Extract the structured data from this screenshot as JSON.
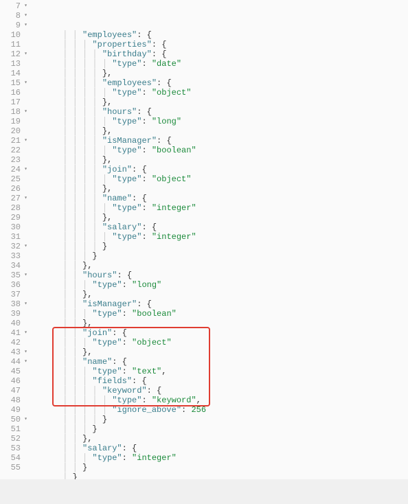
{
  "editor": {
    "gutter": [
      {
        "n": "7",
        "fold": true
      },
      {
        "n": "8",
        "fold": true
      },
      {
        "n": "9",
        "fold": true
      },
      {
        "n": "10",
        "fold": false
      },
      {
        "n": "11",
        "fold": false
      },
      {
        "n": "12",
        "fold": true
      },
      {
        "n": "13",
        "fold": false
      },
      {
        "n": "14",
        "fold": false
      },
      {
        "n": "15",
        "fold": true
      },
      {
        "n": "16",
        "fold": false
      },
      {
        "n": "17",
        "fold": false
      },
      {
        "n": "18",
        "fold": true
      },
      {
        "n": "19",
        "fold": false
      },
      {
        "n": "20",
        "fold": false
      },
      {
        "n": "21",
        "fold": true
      },
      {
        "n": "22",
        "fold": false
      },
      {
        "n": "23",
        "fold": false
      },
      {
        "n": "24",
        "fold": true
      },
      {
        "n": "25",
        "fold": false
      },
      {
        "n": "26",
        "fold": false
      },
      {
        "n": "27",
        "fold": true
      },
      {
        "n": "28",
        "fold": false
      },
      {
        "n": "29",
        "fold": false
      },
      {
        "n": "30",
        "fold": false
      },
      {
        "n": "31",
        "fold": false
      },
      {
        "n": "32",
        "fold": true
      },
      {
        "n": "33",
        "fold": false
      },
      {
        "n": "34",
        "fold": false
      },
      {
        "n": "35",
        "fold": true
      },
      {
        "n": "36",
        "fold": false
      },
      {
        "n": "37",
        "fold": false
      },
      {
        "n": "38",
        "fold": true
      },
      {
        "n": "39",
        "fold": false
      },
      {
        "n": "40",
        "fold": false
      },
      {
        "n": "41",
        "fold": true
      },
      {
        "n": "42",
        "fold": false
      },
      {
        "n": "43",
        "fold": true
      },
      {
        "n": "44",
        "fold": true
      },
      {
        "n": "45",
        "fold": false
      },
      {
        "n": "46",
        "fold": false
      },
      {
        "n": "47",
        "fold": false
      },
      {
        "n": "48",
        "fold": false
      },
      {
        "n": "49",
        "fold": false
      },
      {
        "n": "50",
        "fold": true
      },
      {
        "n": "51",
        "fold": false
      },
      {
        "n": "52",
        "fold": false
      },
      {
        "n": "53",
        "fold": false
      },
      {
        "n": "54",
        "fold": false
      },
      {
        "n": "55",
        "fold": false
      }
    ],
    "lines": [
      [
        [
          "line",
          "      │ │ "
        ],
        [
          "key",
          "\"employees\""
        ],
        [
          "punc",
          ": {"
        ]
      ],
      [
        [
          "line",
          "      │ │ │ "
        ],
        [
          "key",
          "\"properties\""
        ],
        [
          "punc",
          ": {"
        ]
      ],
      [
        [
          "line",
          "      │ │ │ │ "
        ],
        [
          "key",
          "\"birthday\""
        ],
        [
          "punc",
          ": {"
        ]
      ],
      [
        [
          "line",
          "      │ │ │ │ │ "
        ],
        [
          "key",
          "\"type\""
        ],
        [
          "punc",
          ": "
        ],
        [
          "str",
          "\"date\""
        ]
      ],
      [
        [
          "line",
          "      │ │ │ │ "
        ],
        [
          "punc",
          "},"
        ]
      ],
      [
        [
          "line",
          "      │ │ │ │ "
        ],
        [
          "key",
          "\"employees\""
        ],
        [
          "punc",
          ": {"
        ]
      ],
      [
        [
          "line",
          "      │ │ │ │ │ "
        ],
        [
          "key",
          "\"type\""
        ],
        [
          "punc",
          ": "
        ],
        [
          "str",
          "\"object\""
        ]
      ],
      [
        [
          "line",
          "      │ │ │ │ "
        ],
        [
          "punc",
          "},"
        ]
      ],
      [
        [
          "line",
          "      │ │ │ │ "
        ],
        [
          "key",
          "\"hours\""
        ],
        [
          "punc",
          ": {"
        ]
      ],
      [
        [
          "line",
          "      │ │ │ │ │ "
        ],
        [
          "key",
          "\"type\""
        ],
        [
          "punc",
          ": "
        ],
        [
          "str",
          "\"long\""
        ]
      ],
      [
        [
          "line",
          "      │ │ │ │ "
        ],
        [
          "punc",
          "},"
        ]
      ],
      [
        [
          "line",
          "      │ │ │ │ "
        ],
        [
          "key",
          "\"isManager\""
        ],
        [
          "punc",
          ": {"
        ]
      ],
      [
        [
          "line",
          "      │ │ │ │ │ "
        ],
        [
          "key",
          "\"type\""
        ],
        [
          "punc",
          ": "
        ],
        [
          "str",
          "\"boolean\""
        ]
      ],
      [
        [
          "line",
          "      │ │ │ │ "
        ],
        [
          "punc",
          "},"
        ]
      ],
      [
        [
          "line",
          "      │ │ │ │ "
        ],
        [
          "key",
          "\"join\""
        ],
        [
          "punc",
          ": {"
        ]
      ],
      [
        [
          "line",
          "      │ │ │ │ │ "
        ],
        [
          "key",
          "\"type\""
        ],
        [
          "punc",
          ": "
        ],
        [
          "str",
          "\"object\""
        ]
      ],
      [
        [
          "line",
          "      │ │ │ │ "
        ],
        [
          "punc",
          "},"
        ]
      ],
      [
        [
          "line",
          "      │ │ │ │ "
        ],
        [
          "key",
          "\"name\""
        ],
        [
          "punc",
          ": {"
        ]
      ],
      [
        [
          "line",
          "      │ │ │ │ │ "
        ],
        [
          "key",
          "\"type\""
        ],
        [
          "punc",
          ": "
        ],
        [
          "str",
          "\"integer\""
        ]
      ],
      [
        [
          "line",
          "      │ │ │ │ "
        ],
        [
          "punc",
          "},"
        ]
      ],
      [
        [
          "line",
          "      │ │ │ │ "
        ],
        [
          "key",
          "\"salary\""
        ],
        [
          "punc",
          ": {"
        ]
      ],
      [
        [
          "line",
          "      │ │ │ │ │ "
        ],
        [
          "key",
          "\"type\""
        ],
        [
          "punc",
          ": "
        ],
        [
          "str",
          "\"integer\""
        ]
      ],
      [
        [
          "line",
          "      │ │ │ │ "
        ],
        [
          "punc",
          "}"
        ]
      ],
      [
        [
          "line",
          "      │ │ │ "
        ],
        [
          "punc",
          "}"
        ]
      ],
      [
        [
          "line",
          "      │ │ "
        ],
        [
          "punc",
          "},"
        ]
      ],
      [
        [
          "line",
          "      │ │ "
        ],
        [
          "key",
          "\"hours\""
        ],
        [
          "punc",
          ": {"
        ]
      ],
      [
        [
          "line",
          "      │ │ │ "
        ],
        [
          "key",
          "\"type\""
        ],
        [
          "punc",
          ": "
        ],
        [
          "str",
          "\"long\""
        ]
      ],
      [
        [
          "line",
          "      │ │ "
        ],
        [
          "punc",
          "},"
        ]
      ],
      [
        [
          "line",
          "      │ │ "
        ],
        [
          "key",
          "\"isManager\""
        ],
        [
          "punc",
          ": {"
        ]
      ],
      [
        [
          "line",
          "      │ │ │ "
        ],
        [
          "key",
          "\"type\""
        ],
        [
          "punc",
          ": "
        ],
        [
          "str",
          "\"boolean\""
        ]
      ],
      [
        [
          "line",
          "      │ │ "
        ],
        [
          "punc",
          "},"
        ]
      ],
      [
        [
          "line",
          "      │ │ "
        ],
        [
          "key",
          "\"join\""
        ],
        [
          "punc",
          ": {"
        ]
      ],
      [
        [
          "line",
          "      │ │ │ "
        ],
        [
          "key",
          "\"type\""
        ],
        [
          "punc",
          ": "
        ],
        [
          "str",
          "\"object\""
        ]
      ],
      [
        [
          "line",
          "      │ │ "
        ],
        [
          "punc",
          "},"
        ]
      ],
      [
        [
          "line",
          "      │ │ "
        ],
        [
          "key",
          "\"name\""
        ],
        [
          "punc",
          ": {"
        ]
      ],
      [
        [
          "line",
          "      │ │ │ "
        ],
        [
          "key",
          "\"type\""
        ],
        [
          "punc",
          ": "
        ],
        [
          "str",
          "\"text\""
        ],
        [
          "punc",
          ","
        ]
      ],
      [
        [
          "line",
          "      │ │ │ "
        ],
        [
          "key",
          "\"fields\""
        ],
        [
          "punc",
          ": {"
        ]
      ],
      [
        [
          "line",
          "      │ │ │ │ "
        ],
        [
          "key",
          "\"keyword\""
        ],
        [
          "punc",
          ": {"
        ]
      ],
      [
        [
          "line",
          "      │ │ │ │ │ "
        ],
        [
          "key",
          "\"type\""
        ],
        [
          "punc",
          ": "
        ],
        [
          "str",
          "\"keyword\""
        ],
        [
          "punc",
          ","
        ]
      ],
      [
        [
          "line",
          "      │ │ │ │ │ "
        ],
        [
          "key",
          "\"ignore_above\""
        ],
        [
          "punc",
          ": "
        ],
        [
          "num",
          "256"
        ]
      ],
      [
        [
          "line",
          "      │ │ │ │ "
        ],
        [
          "punc",
          "}"
        ]
      ],
      [
        [
          "line",
          "      │ │ │ "
        ],
        [
          "punc",
          "}"
        ]
      ],
      [
        [
          "line",
          "      │ │ "
        ],
        [
          "punc",
          "},"
        ]
      ],
      [
        [
          "line",
          "      │ │ "
        ],
        [
          "key",
          "\"salary\""
        ],
        [
          "punc",
          ": {"
        ]
      ],
      [
        [
          "line",
          "      │ │ │ "
        ],
        [
          "key",
          "\"type\""
        ],
        [
          "punc",
          ": "
        ],
        [
          "str",
          "\"integer\""
        ]
      ],
      [
        [
          "line",
          "      │ │ "
        ],
        [
          "punc",
          "}"
        ]
      ],
      [
        [
          "line",
          "      │ "
        ],
        [
          "punc",
          "}"
        ]
      ],
      [
        [
          "line",
          "      "
        ],
        [
          "punc",
          "}"
        ]
      ],
      [
        [
          "line",
          "    "
        ],
        [
          "punc",
          "}"
        ]
      ]
    ],
    "highlight": {
      "start_line_index": 34,
      "end_line_index": 41
    }
  }
}
